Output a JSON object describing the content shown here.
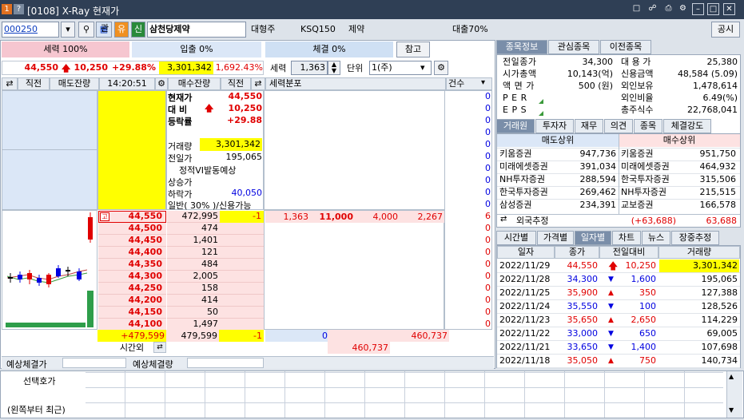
{
  "window": {
    "badge1": "1",
    "badge2": "?",
    "title": "[0108] X-Ray 현재가"
  },
  "toolbar": {
    "code": "000250",
    "tag_gwan": "관",
    "tag_yu": "유",
    "tag_sin": "신",
    "stock_name": "삼천당제약",
    "market_type": "대형주",
    "index": "KSQ150",
    "sector": "제약",
    "loan_rate": "대출70%",
    "notice": "공시"
  },
  "power": {
    "strength_label": "세력 100%",
    "inflow_label": "입출 0%",
    "fill_label": "체결 0%",
    "ref_button": "참고"
  },
  "summary": {
    "price": "44,550",
    "change": "10,250",
    "rate": "+29.88%",
    "volume": "3,301,342",
    "vol_ratio": "1,692.43%",
    "strength_label": "세력",
    "strength_value": "1,363",
    "unit_label": "단위",
    "unit_value": "1(주)"
  },
  "orderbook_header": {
    "prev": "직전",
    "ask_rem": "매도잔량",
    "time": "14:20:51",
    "bid_rem": "매수잔량",
    "prev2": "직전",
    "dist": "세력분포",
    "count": "건수"
  },
  "info": {
    "cur_label": "현재가",
    "cur_value": "44,550",
    "diff_label": "대 비",
    "diff_value": "10,250",
    "rate_label": "등락률",
    "rate_value": "+29.88",
    "vol_label": "거래량",
    "vol_value": "3,301,342",
    "prev_label": "전일가",
    "prev_value": "195,065",
    "vi_label": "정적VI발동예상",
    "upper_label": "상승가",
    "lower_label": "하락가",
    "lower_value": "40,050",
    "general_label": "일반( 30% )/신용가능"
  },
  "asks": [
    {
      "price": "44,550",
      "qty": "472,995",
      "prev": "-1",
      "tag": "고"
    },
    {
      "price": "44,500",
      "qty": "474",
      "prev": ""
    },
    {
      "price": "44,450",
      "qty": "1,401",
      "prev": ""
    },
    {
      "price": "44,400",
      "qty": "121",
      "prev": ""
    },
    {
      "price": "44,350",
      "qty": "484",
      "prev": ""
    },
    {
      "price": "44,300",
      "qty": "2,005",
      "prev": ""
    },
    {
      "price": "44,250",
      "qty": "158",
      "prev": ""
    },
    {
      "price": "44,200",
      "qty": "414",
      "prev": ""
    },
    {
      "price": "44,150",
      "qty": "50",
      "prev": ""
    },
    {
      "price": "44,100",
      "qty": "1,497",
      "prev": ""
    }
  ],
  "dist_row": {
    "a": "1,363",
    "b": "11,000",
    "c": "4,000",
    "d": "2,267"
  },
  "counts": [
    "0",
    "0",
    "0",
    "0",
    "0",
    "0",
    "0",
    "0",
    "0",
    "0",
    "6",
    "0",
    "0",
    "0",
    "0",
    "0",
    "0",
    "0",
    "0",
    "0"
  ],
  "totals": {
    "diff": "+479,599",
    "bid_total": "479,599",
    "prev": "-1",
    "sum_a": "0",
    "sum_b": "460,737",
    "sum_c": "460,737",
    "after_hours": "시간외"
  },
  "expected": {
    "price_label": "예상체결가",
    "qty_label": "예상체결량"
  },
  "bottom": {
    "select_label": "선택호가",
    "recent_label": "(왼쪽부터 최근)"
  },
  "tabs_top": [
    "종목정보",
    "관심종목",
    "이전종목"
  ],
  "stock_info": [
    {
      "l1": "전일종가",
      "v1": "34,300",
      "l2": "대 용 가",
      "v2": "25,380"
    },
    {
      "l1": "시가총액",
      "v1": "10,143(억)",
      "l2": "신용금액",
      "v2": "48,584  (5.09)"
    },
    {
      "l1": "액 면 가",
      "v1": "500 (원)",
      "l2": "외인보유",
      "v2": "1,478,614"
    },
    {
      "l1": "P E R",
      "v1": "",
      "l2": "외인비율",
      "v2": "6.49(%)"
    },
    {
      "l1": "E P S",
      "v1": "",
      "l2": "총주식수",
      "v2": "22,768,041"
    }
  ],
  "tabs_mid": [
    "거래원",
    "투자자",
    "재무",
    "의견",
    "종목",
    "체결강도"
  ],
  "brokers": {
    "sell_header": "매도상위",
    "buy_header": "매수상위",
    "rows": [
      {
        "s": "키움증권",
        "sv": "947,736",
        "b": "키움증권",
        "bv": "951,750"
      },
      {
        "s": "미래에셋증권",
        "sv": "391,034",
        "b": "미래에셋증권",
        "bv": "464,932"
      },
      {
        "s": "NH투자증권",
        "sv": "288,594",
        "b": "한국투자증권",
        "bv": "315,506"
      },
      {
        "s": "한국투자증권",
        "sv": "269,462",
        "b": "NH투자증권",
        "bv": "215,515"
      },
      {
        "s": "삼성증권",
        "sv": "234,391",
        "b": "교보증권",
        "bv": "166,578"
      }
    ],
    "foreign_label": "외국추정",
    "foreign_sell": "(+63,688)",
    "foreign_buy": "63,688"
  },
  "tabs_bot": [
    "시간별",
    "가격별",
    "일자별",
    "차트",
    "뉴스",
    "장중추정"
  ],
  "daily": {
    "headers": [
      "일자",
      "종가",
      "전일대비",
      "거래량"
    ],
    "rows": [
      {
        "date": "2022/11/29",
        "close": "44,550",
        "dir": "up2",
        "chg": "10,250",
        "vol": "3,301,342"
      },
      {
        "date": "2022/11/28",
        "close": "34,300",
        "dir": "down",
        "chg": "1,600",
        "vol": "195,065"
      },
      {
        "date": "2022/11/25",
        "close": "35,900",
        "dir": "up",
        "chg": "350",
        "vol": "127,388"
      },
      {
        "date": "2022/11/24",
        "close": "35,550",
        "dir": "down",
        "chg": "100",
        "vol": "128,526"
      },
      {
        "date": "2022/11/23",
        "close": "35,650",
        "dir": "up",
        "chg": "2,650",
        "vol": "114,229"
      },
      {
        "date": "2022/11/22",
        "close": "33,000",
        "dir": "down",
        "chg": "650",
        "vol": "69,005"
      },
      {
        "date": "2022/11/21",
        "close": "33,650",
        "dir": "down",
        "chg": "1,400",
        "vol": "107,698"
      },
      {
        "date": "2022/11/18",
        "close": "35,050",
        "dir": "up",
        "chg": "750",
        "vol": "140,734"
      }
    ]
  },
  "colors": {
    "up": "#e00000",
    "down": "#0000e0",
    "highlight": "#ffff00",
    "ask_bg": "#dbe7f7",
    "bid_bg": "#fde2e2",
    "title_bar": "#2f3f55"
  }
}
